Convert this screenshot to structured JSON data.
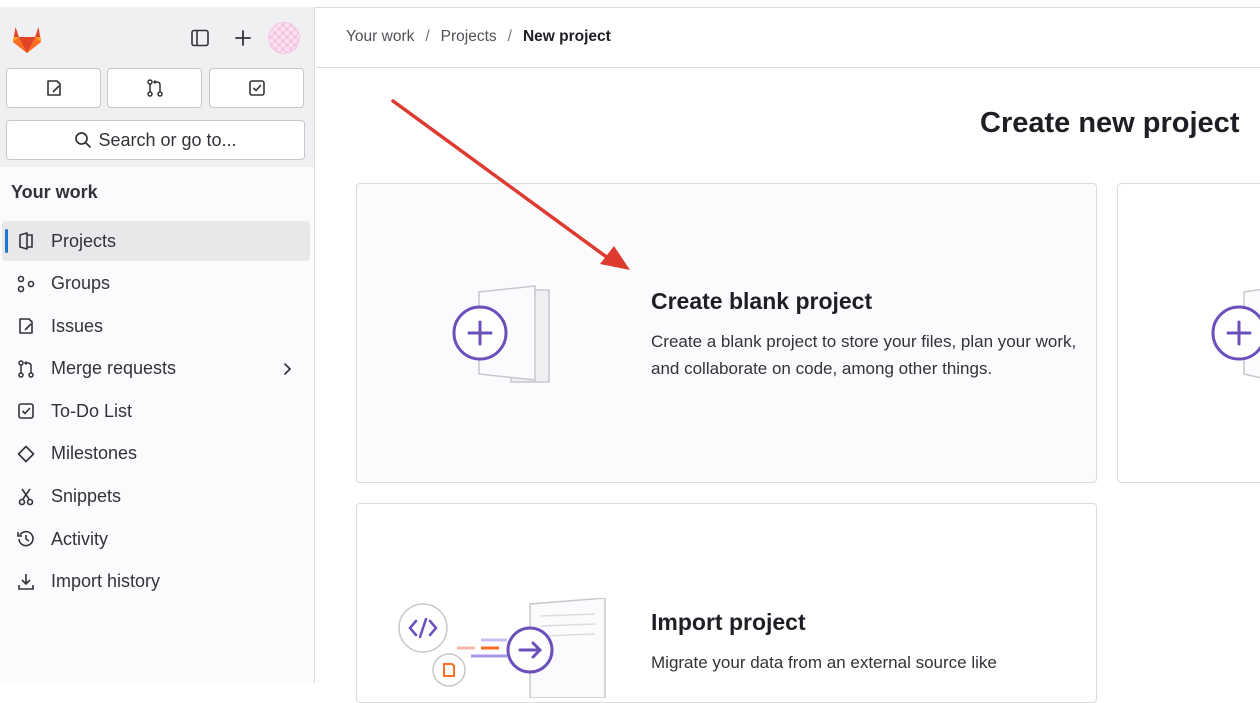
{
  "sidebar": {
    "section_title": "Your work",
    "search_label": "Search or go to...",
    "items": [
      {
        "label": "Projects",
        "icon": "project-icon",
        "active": true
      },
      {
        "label": "Groups",
        "icon": "group-icon"
      },
      {
        "label": "Issues",
        "icon": "issues-icon"
      },
      {
        "label": "Merge requests",
        "icon": "merge-request-icon",
        "expandable": true
      },
      {
        "label": "To-Do List",
        "icon": "todo-icon"
      },
      {
        "label": "Milestones",
        "icon": "milestone-icon"
      },
      {
        "label": "Snippets",
        "icon": "snippet-icon"
      },
      {
        "label": "Activity",
        "icon": "history-icon"
      },
      {
        "label": "Import history",
        "icon": "import-icon"
      }
    ]
  },
  "breadcrumb": {
    "items": [
      "Your work",
      "Projects",
      "New project"
    ]
  },
  "main": {
    "title": "Create new project",
    "cards": [
      {
        "title": "Create blank project",
        "description": "Create a blank project to store your files, plan your work, and collaborate on code, among other things."
      },
      {
        "title": "Import project",
        "description": "Migrate your data from an external source like"
      }
    ]
  },
  "colors": {
    "accent": "#6b4fbb",
    "active_indicator": "#1f75cb",
    "annotation_arrow": "#dd3b2f"
  }
}
